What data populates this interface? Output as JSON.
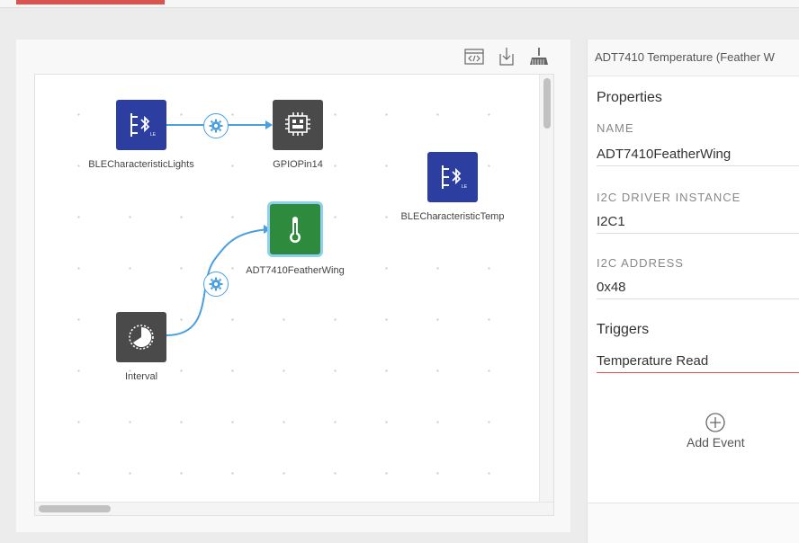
{
  "canvas": {
    "nodes": [
      {
        "id": "ble-lights",
        "label": "BLECharacteristicLights",
        "icon": "bluetooth-characteristic-icon",
        "color": "#2c3e9f"
      },
      {
        "id": "gpio",
        "label": "GPIOPin14",
        "icon": "gpio-icon",
        "color": "#4a4a4a"
      },
      {
        "id": "ble-temp",
        "label": "BLECharacteristicTemp",
        "icon": "bluetooth-characteristic-icon",
        "color": "#2c3e9f"
      },
      {
        "id": "adt",
        "label": "ADT7410FeatherWing",
        "icon": "thermometer-icon",
        "color": "#2e8b3e"
      },
      {
        "id": "interval",
        "label": "Interval",
        "icon": "timer-icon",
        "color": "#4a4a4a"
      }
    ]
  },
  "properties": {
    "title": "ADT7410 Temperature (Feather W",
    "section_title": "Properties",
    "fields": [
      {
        "label": "NAME",
        "value": "ADT7410FeatherWing"
      },
      {
        "label": "I2C DRIVER INSTANCE",
        "value": "I2C1"
      },
      {
        "label": "I2C ADDRESS",
        "value": "0x48"
      }
    ],
    "triggers_title": "Triggers",
    "trigger_value": "Temperature Read",
    "add_event_label": "Add Event"
  },
  "colors": {
    "accent_red": "#d9534f",
    "link_blue": "#4a9fe0",
    "selected_glow": "#8fd0f0"
  }
}
